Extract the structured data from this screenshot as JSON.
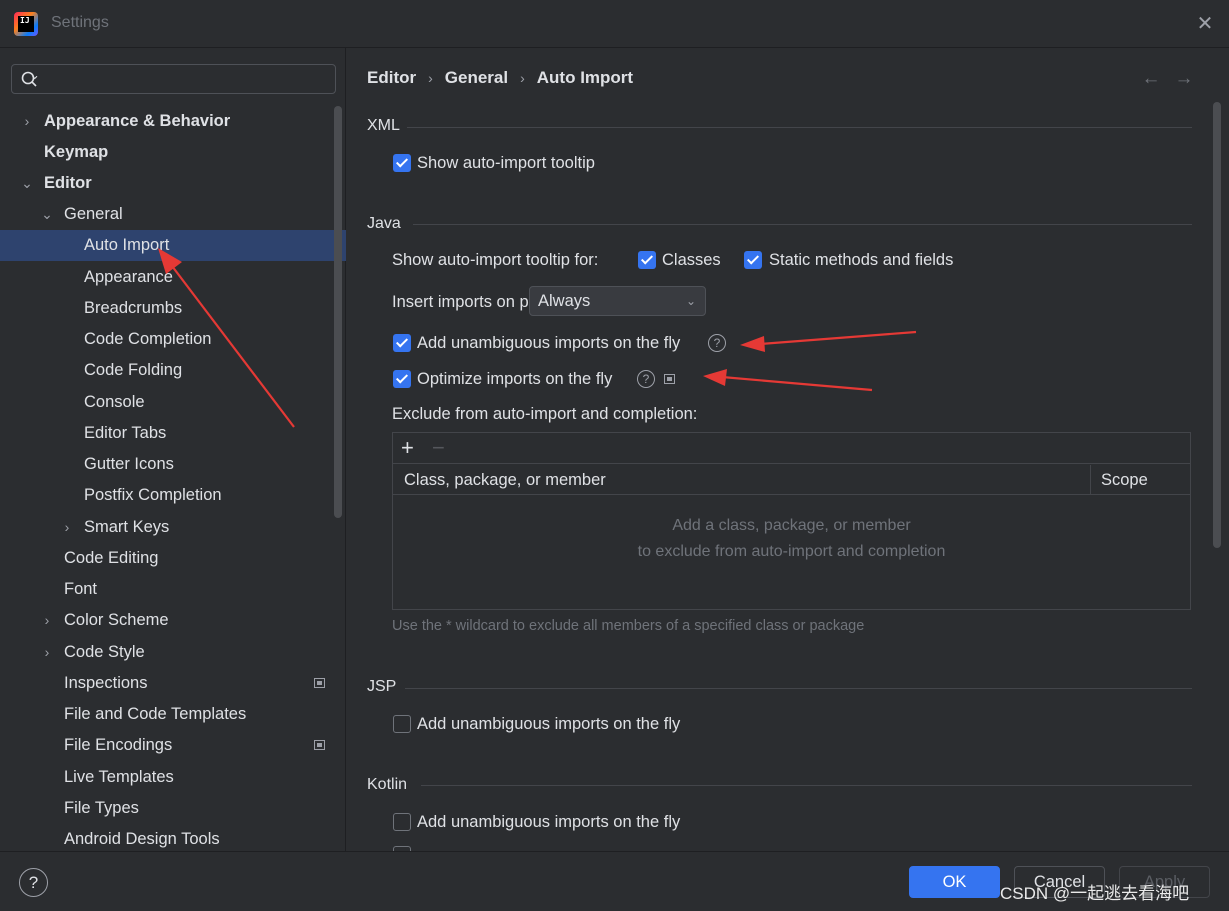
{
  "window": {
    "title": "Settings"
  },
  "search": {
    "placeholder": "",
    "value": ""
  },
  "sidebar": {
    "items": [
      {
        "label": "Appearance & Behavior",
        "chevron": "›",
        "bold": true
      },
      {
        "label": "Keymap",
        "chevron": "",
        "bold": true
      },
      {
        "label": "Editor",
        "chevron": "⌄",
        "bold": true
      },
      {
        "label": "General",
        "chevron": "⌄"
      },
      {
        "label": "Auto Import",
        "chevron": "",
        "selected": true
      },
      {
        "label": "Appearance",
        "chevron": ""
      },
      {
        "label": "Breadcrumbs",
        "chevron": ""
      },
      {
        "label": "Code Completion",
        "chevron": ""
      },
      {
        "label": "Code Folding",
        "chevron": ""
      },
      {
        "label": "Console",
        "chevron": ""
      },
      {
        "label": "Editor Tabs",
        "chevron": ""
      },
      {
        "label": "Gutter Icons",
        "chevron": ""
      },
      {
        "label": "Postfix Completion",
        "chevron": ""
      },
      {
        "label": "Smart Keys",
        "chevron": "›"
      },
      {
        "label": "Code Editing",
        "chevron": ""
      },
      {
        "label": "Font",
        "chevron": ""
      },
      {
        "label": "Color Scheme",
        "chevron": "›"
      },
      {
        "label": "Code Style",
        "chevron": "›"
      },
      {
        "label": "Inspections",
        "chevron": "",
        "badge": true
      },
      {
        "label": "File and Code Templates",
        "chevron": ""
      },
      {
        "label": "File Encodings",
        "chevron": "",
        "badge": true
      },
      {
        "label": "Live Templates",
        "chevron": ""
      },
      {
        "label": "File Types",
        "chevron": ""
      },
      {
        "label": "Android Design Tools",
        "chevron": ""
      }
    ]
  },
  "breadcrumb": {
    "items": [
      "Editor",
      "General",
      "Auto Import"
    ],
    "separator": "›"
  },
  "nav": {
    "back": "←",
    "forward": "→"
  },
  "sections": {
    "xml": {
      "title": "XML",
      "show_tooltip": {
        "label": "Show auto-import tooltip",
        "checked": true
      }
    },
    "java": {
      "title": "Java",
      "tooltip_for_label": "Show auto-import tooltip for:",
      "classes": {
        "label": "Classes",
        "checked": true
      },
      "static": {
        "label": "Static methods and fields",
        "checked": true
      },
      "insert_on_paste_label": "Insert imports on paste:",
      "insert_on_paste_value": "Always",
      "unambiguous": {
        "label": "Add unambiguous imports on the fly",
        "checked": true
      },
      "optimize": {
        "label": "Optimize imports on the fly",
        "checked": true
      },
      "exclude_label": "Exclude from auto-import and completion:",
      "table": {
        "add": "+",
        "remove": "−",
        "columns": [
          "Class, package, or member",
          "Scope"
        ],
        "empty_line1": "Add a class, package, or member",
        "empty_line2": "to exclude from auto-import and completion"
      },
      "hint": "Use the * wildcard to exclude all members of a specified class or package"
    },
    "jsp": {
      "title": "JSP",
      "unambiguous": {
        "label": "Add unambiguous imports on the fly",
        "checked": false
      }
    },
    "kotlin": {
      "title": "Kotlin",
      "unambiguous": {
        "label": "Add unambiguous imports on the fly",
        "checked": false
      }
    }
  },
  "footer": {
    "help": "?",
    "ok": "OK",
    "cancel": "Cancel",
    "apply": "Apply"
  },
  "watermark": "CSDN @一起逃去看海吧",
  "colors": {
    "accent": "#3574f0",
    "selection": "#2e436e",
    "annotation_arrow": "#e53935"
  }
}
